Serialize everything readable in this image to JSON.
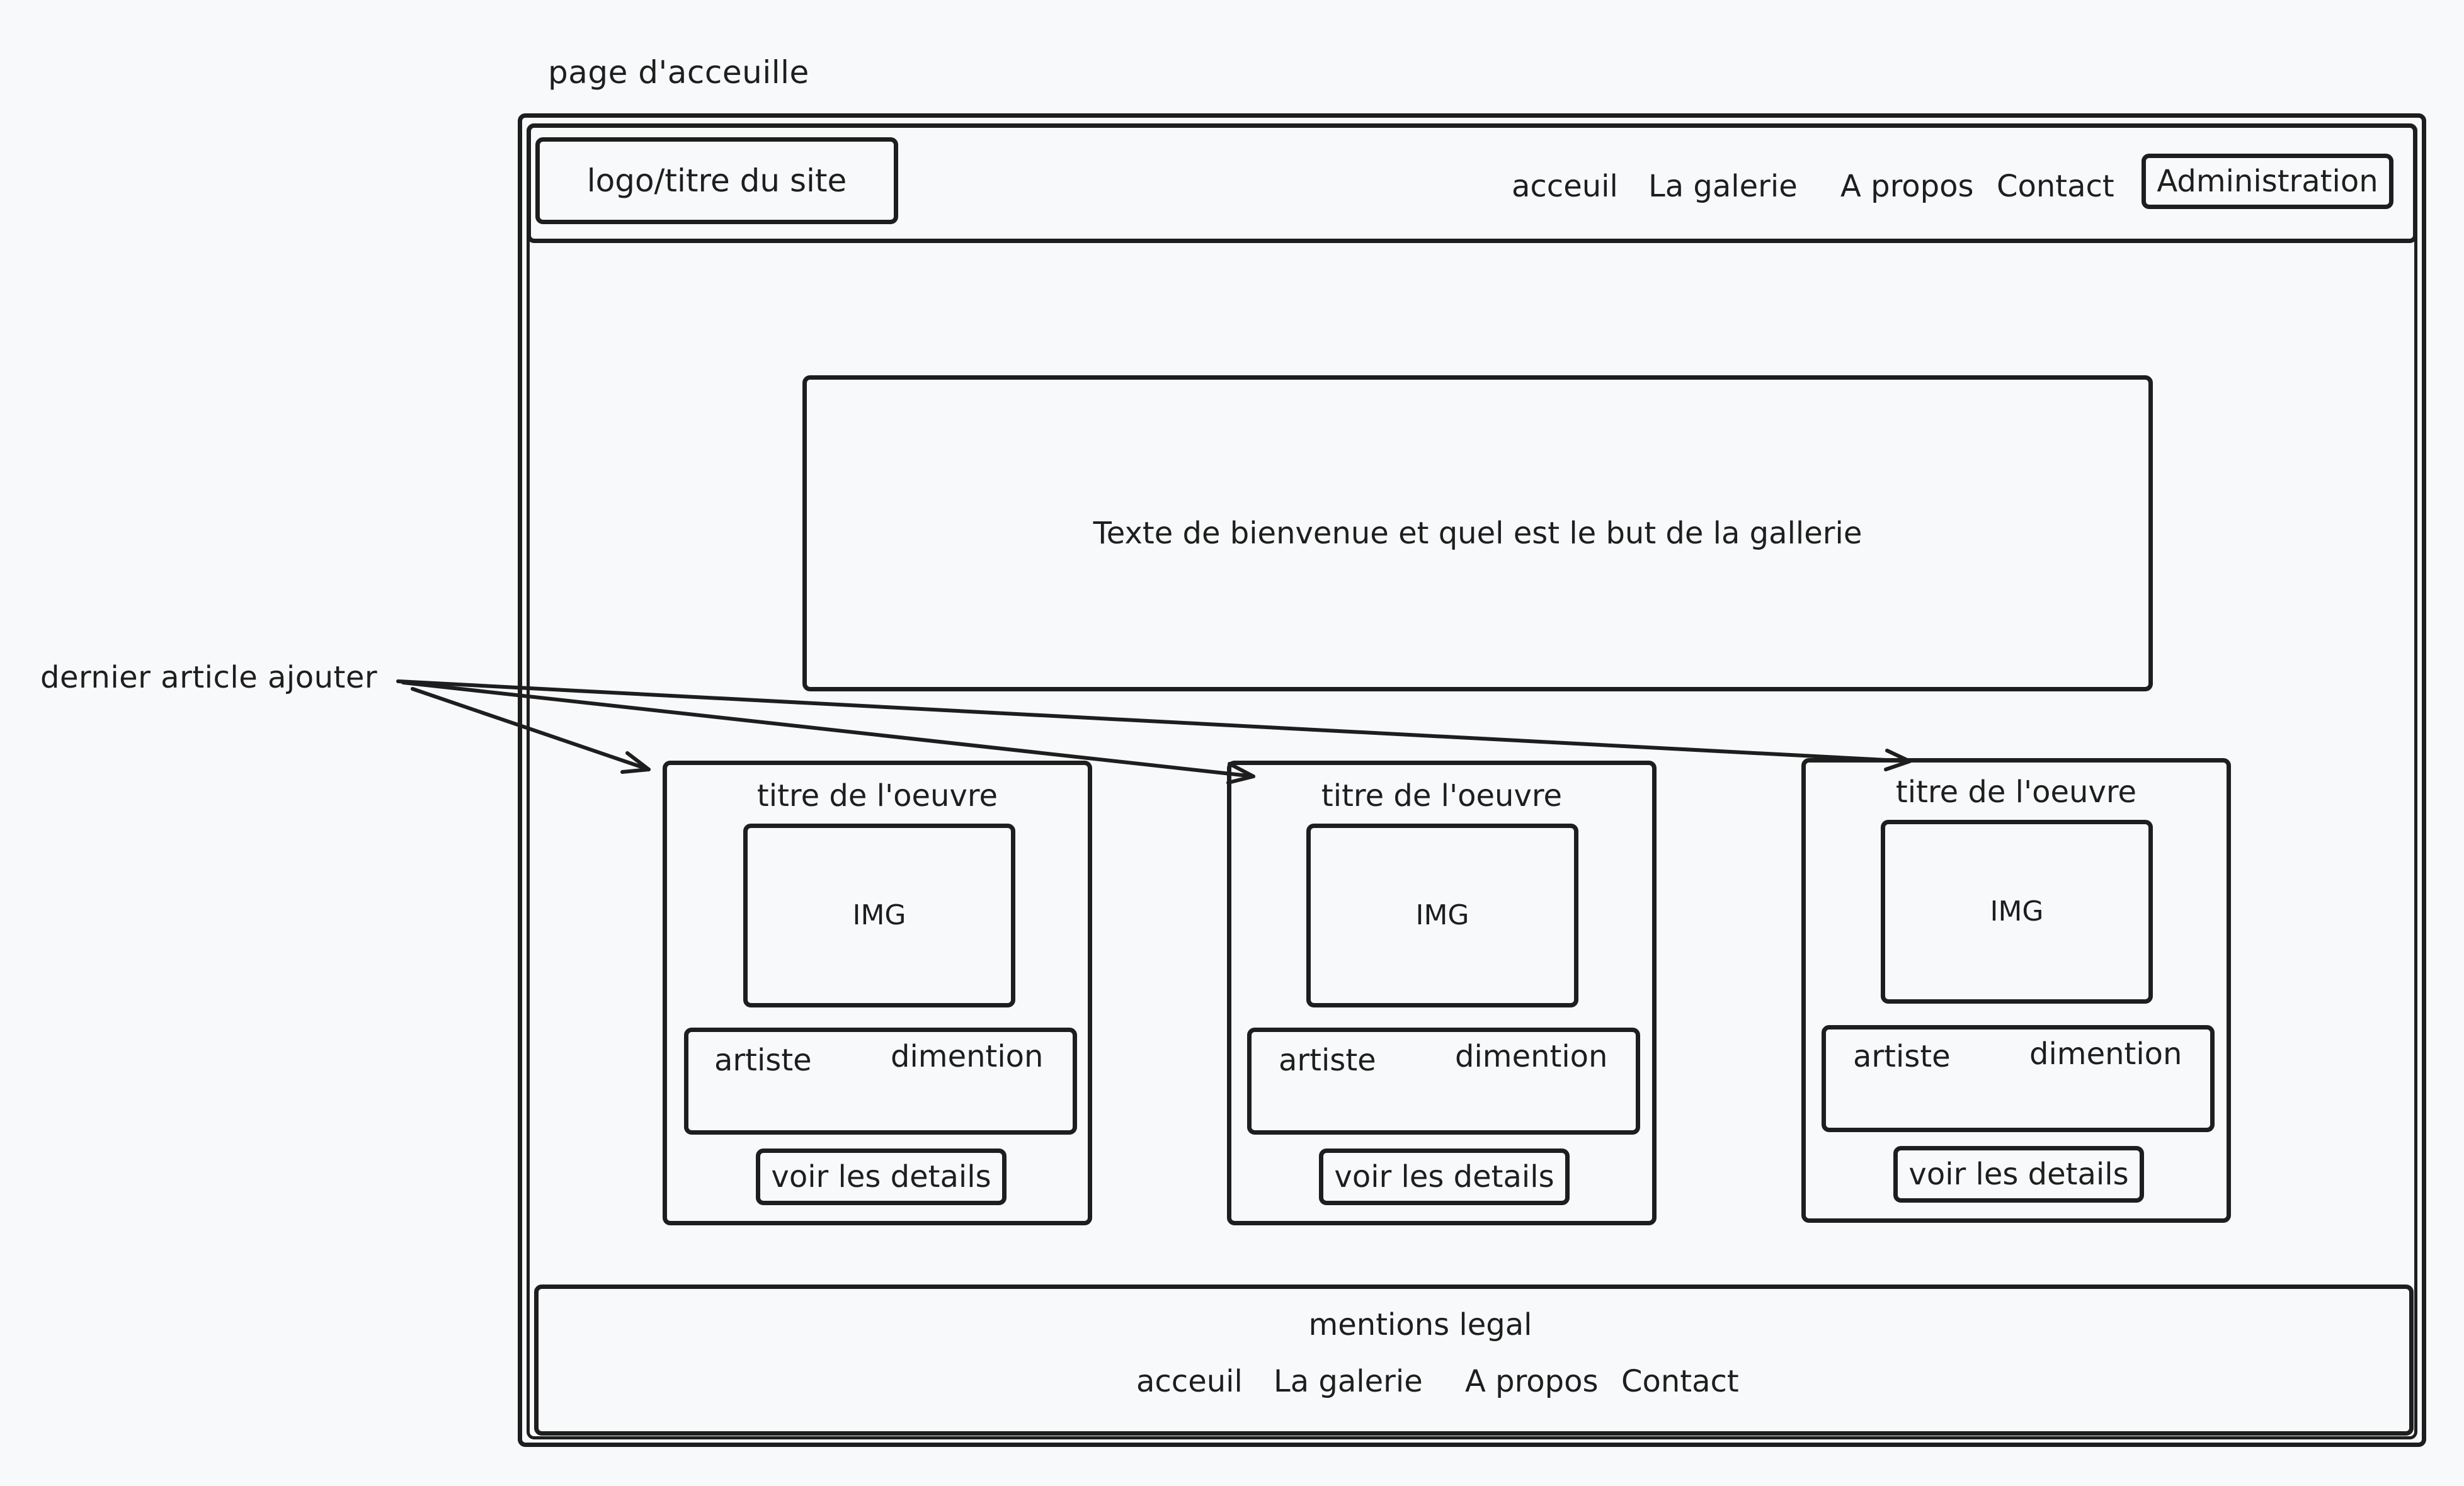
{
  "page_title": "page d'acceuille",
  "header": {
    "logo_label": "logo/titre du site",
    "nav": [
      "acceuil",
      "La galerie",
      "A propos",
      "Contact"
    ],
    "admin_label": "Administration"
  },
  "hero": {
    "text": "Texte de bienvenue et quel est le but de la gallerie"
  },
  "annotation": {
    "label": "dernier article ajouter"
  },
  "cards": [
    {
      "title": "titre de l'oeuvre",
      "img": "IMG",
      "artist": "artiste",
      "dimension": "dimention",
      "button": "voir les details"
    },
    {
      "title": "titre de l'oeuvre",
      "img": "IMG",
      "artist": "artiste",
      "dimension": "dimention",
      "button": "voir les details"
    },
    {
      "title": "titre de l'oeuvre",
      "img": "IMG",
      "artist": "artiste",
      "dimension": "dimention",
      "button": "voir les details"
    }
  ],
  "footer": {
    "legal": "mentions legal",
    "nav": [
      "acceuil",
      "La galerie",
      "A propos",
      "Contact"
    ]
  }
}
